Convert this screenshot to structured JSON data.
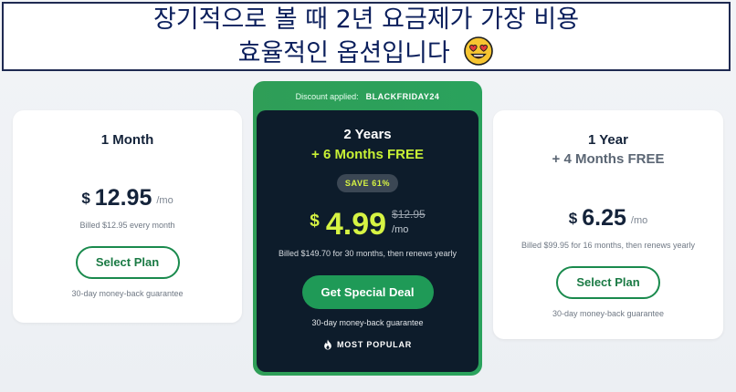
{
  "banner": {
    "line1": "장기적으로 볼 때 2년 요금제가 가장 비용",
    "line2": "효율적인 옵션입니다",
    "emoji_icon": "heart-eyes-emoji-icon"
  },
  "plans": {
    "monthly": {
      "title": "1 Month",
      "currency": "$",
      "price": "12.95",
      "period": "/mo",
      "billed": "Billed $12.95 every month",
      "button": "Select Plan",
      "guarantee": "30-day money-back guarantee"
    },
    "two_year": {
      "discount_label": "Discount applied:",
      "discount_code": "BLACKFRIDAY24",
      "title": "2 Years",
      "subtitle": "+ 6 Months FREE",
      "save_badge": "SAVE 61%",
      "currency": "$",
      "price": "4.99",
      "old_price": "$12.95",
      "period": "/mo",
      "billed": "Billed $149.70 for 30 months, then renews yearly",
      "button": "Get Special Deal",
      "guarantee": "30-day money-back guarantee",
      "popular": "MOST POPULAR",
      "popular_icon": "flame-icon"
    },
    "yearly": {
      "title": "1 Year",
      "subtitle": "+ 4 Months FREE",
      "currency": "$",
      "price": "6.25",
      "period": "/mo",
      "billed": "Billed $99.95 for 16 months, then renews yearly",
      "button": "Select Plan",
      "guarantee": "30-day money-back guarantee"
    }
  },
  "colors": {
    "accent_green": "#1f9a57",
    "highlight_lime": "#d6f343",
    "featured_bg": "#0d1c2b",
    "banner_text": "#0b1f5c"
  }
}
